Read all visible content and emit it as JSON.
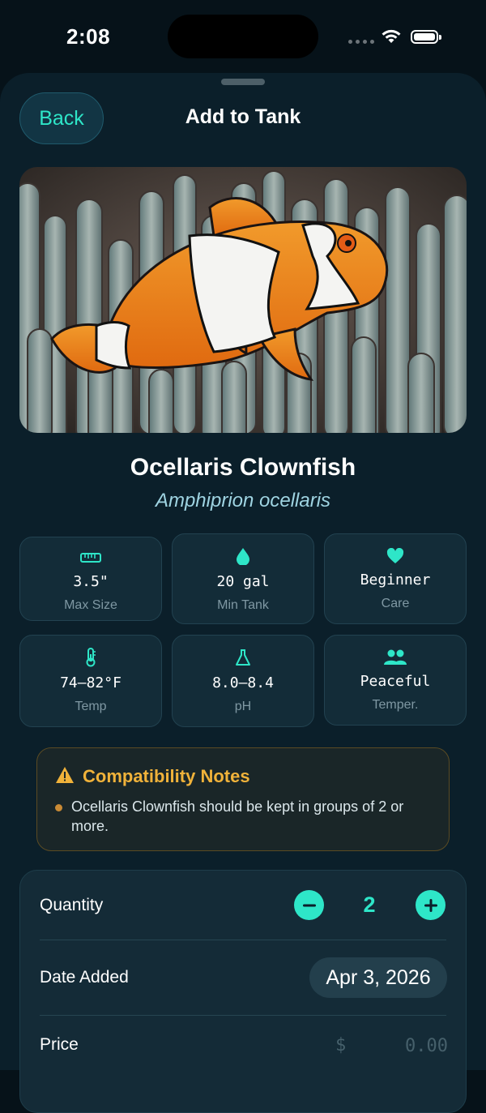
{
  "status_bar": {
    "time": "2:08"
  },
  "header": {
    "back_label": "Back",
    "title": "Add to Tank"
  },
  "species": {
    "common_name": "Ocellaris Clownfish",
    "scientific_name": "Amphiprion ocellaris"
  },
  "stats": [
    {
      "icon": "ruler-icon",
      "value": "3.5\"",
      "label": "Max Size"
    },
    {
      "icon": "water-drop-icon",
      "value": "20 gal",
      "label": "Min Tank"
    },
    {
      "icon": "heart-icon",
      "value": "Beginner",
      "label": "Care"
    },
    {
      "icon": "thermometer-icon",
      "value": "74–82°F",
      "label": "Temp"
    },
    {
      "icon": "flask-icon",
      "value": "8.0–8.4",
      "label": "pH"
    },
    {
      "icon": "group-icon",
      "value": "Peaceful",
      "label": "Temper."
    }
  ],
  "compatibility": {
    "title": "Compatibility Notes",
    "notes": [
      "Ocellaris Clownfish should be kept in groups of 2 or more."
    ]
  },
  "form": {
    "quantity_label": "Quantity",
    "quantity_value": "2",
    "date_label": "Date Added",
    "date_value": "Apr 3, 2026",
    "price_label": "Price",
    "price_currency": "$",
    "price_placeholder": "0.00"
  },
  "colors": {
    "accent": "#2ee6c8",
    "warning": "#f0b23a",
    "background": "#0b1f2a"
  }
}
